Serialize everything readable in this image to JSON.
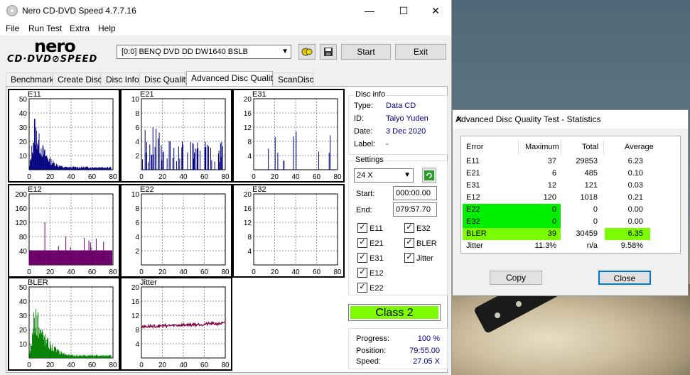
{
  "window": {
    "title": "Nero CD-DVD Speed 4.7.7.16",
    "minimize": "—",
    "maximize": "☐",
    "close": "✕"
  },
  "menu": [
    "File",
    "Run Test",
    "Extra",
    "Help"
  ],
  "logo": {
    "top": "nero",
    "bottom": "CD·DVD⊘SPEED"
  },
  "toolbar": {
    "drive": "[0:0]   BENQ DVD DD DW1640 BSLB",
    "start": "Start",
    "exit": "Exit",
    "icons": [
      "eject-icon",
      "save-icon"
    ]
  },
  "tabs": [
    "Benchmark",
    "Create Disc",
    "Disc Info",
    "Disc Quality",
    "Advanced Disc Quality",
    "ScanDisc"
  ],
  "active_tab": "Advanced Disc Quality",
  "disc_info": {
    "legend": "Disc info",
    "type_label": "Type:",
    "type": "Data CD",
    "id_label": "ID:",
    "id": "Taiyo Yuden",
    "date_label": "Date:",
    "date": "3 Dec 2020",
    "label_label": "Label:",
    "label": "-"
  },
  "settings": {
    "legend": "Settings",
    "speed": "24 X",
    "start_label": "Start:",
    "start": "000:00.00",
    "end_label": "End:",
    "end": "079:57.70",
    "checkboxes": [
      {
        "label": "E11",
        "checked": true
      },
      {
        "label": "E32",
        "checked": true
      },
      {
        "label": "E21",
        "checked": true
      },
      {
        "label": "BLER",
        "checked": true
      },
      {
        "label": "E31",
        "checked": true
      },
      {
        "label": "Jitter",
        "checked": true
      },
      {
        "label": "E12",
        "checked": true
      },
      {
        "label": "E22",
        "checked": true
      }
    ]
  },
  "class": "Class 2",
  "progress": {
    "progress_label": "Progress:",
    "progress": "100 %",
    "position_label": "Position:",
    "position": "79:55.00",
    "speed_label": "Speed:",
    "speed": "27.05 X"
  },
  "colors": {
    "navy": "#00007f",
    "purple": "#6b006b",
    "green": "#007f00",
    "jitter": "#800040",
    "class_bg": "#7cfc00"
  },
  "charts": [
    {
      "name": "E11",
      "yticks": [
        "50",
        "40",
        "30",
        "20",
        "10"
      ],
      "ymax": 50,
      "color": "#00007f",
      "kind": "area",
      "profile": "e11"
    },
    {
      "name": "E21",
      "yticks": [
        "10",
        "8",
        "6",
        "4",
        "2"
      ],
      "ymax": 10,
      "color": "#00007f",
      "kind": "spikes",
      "profile": "e21"
    },
    {
      "name": "E31",
      "yticks": [
        "20",
        "16",
        "12",
        "8",
        "4"
      ],
      "ymax": 20,
      "color": "#00007f",
      "kind": "spikes",
      "profile": "e31"
    },
    {
      "name": "E12",
      "yticks": [
        "200",
        "160",
        "120",
        "80",
        "40"
      ],
      "ymax": 200,
      "color": "#6b006b",
      "kind": "spikes",
      "profile": "e12"
    },
    {
      "name": "E22",
      "yticks": [
        "10",
        "8",
        "6",
        "4",
        "2"
      ],
      "ymax": 10,
      "color": "#00007f",
      "kind": "none",
      "profile": "none"
    },
    {
      "name": "E32",
      "yticks": [
        "20",
        "16",
        "12",
        "8",
        "4"
      ],
      "ymax": 20,
      "color": "#00007f",
      "kind": "none",
      "profile": "none"
    },
    {
      "name": "BLER",
      "yticks": [
        "50",
        "40",
        "30",
        "20",
        "10"
      ],
      "ymax": 50,
      "color": "#007f00",
      "kind": "area",
      "profile": "bler"
    },
    {
      "name": "Jitter",
      "yticks": [
        "20",
        "16",
        "12",
        "8",
        "4"
      ],
      "ymax": 20,
      "color": "#800040",
      "kind": "line",
      "profile": "jitter"
    }
  ],
  "xticks": [
    "0",
    "20",
    "40",
    "60",
    "80"
  ],
  "stats_dialog": {
    "title": "Advanced Disc Quality Test - Statistics",
    "headers": [
      "Error",
      "Maximum",
      "Total",
      "Average"
    ],
    "rows": [
      {
        "error": "E11",
        "max": "37",
        "total": "29853",
        "avg": "6.23"
      },
      {
        "error": "E21",
        "max": "6",
        "total": "485",
        "avg": "0.10"
      },
      {
        "error": "E31",
        "max": "12",
        "total": "121",
        "avg": "0.03"
      },
      {
        "error": "E12",
        "max": "120",
        "total": "1018",
        "avg": "0.21"
      },
      {
        "error": "E22",
        "max": "0",
        "total": "0",
        "avg": "0.00"
      },
      {
        "error": "E32",
        "max": "0",
        "total": "0",
        "avg": "0.00"
      },
      {
        "error": "BLER",
        "max": "39",
        "total": "30459",
        "avg": "6.35"
      },
      {
        "error": "Jitter",
        "max": "11.3%",
        "total": "n/a",
        "avg": "9.58%"
      }
    ],
    "copy": "Copy",
    "close": "Close"
  }
}
